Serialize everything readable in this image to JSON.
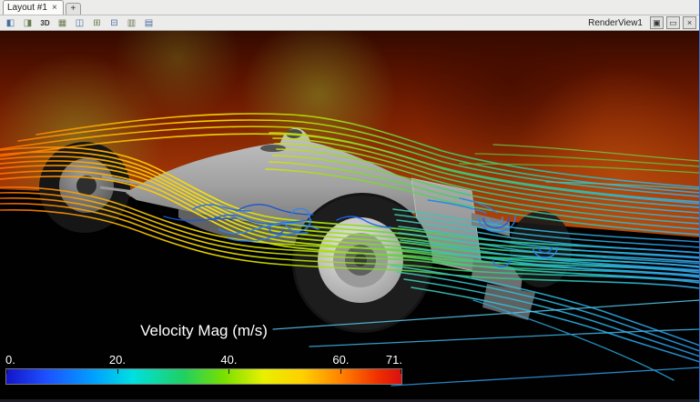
{
  "tabbar": {
    "tab_label": "Layout #1",
    "close_glyph": "×",
    "add_glyph": "+"
  },
  "toolbar": {
    "view_label": "RenderView1",
    "icons": [
      {
        "name": "split-horizontal",
        "glyph": "◧"
      },
      {
        "name": "split-vertical",
        "glyph": "◨"
      },
      {
        "name": "interaction-mode-3d",
        "glyph": "3D"
      },
      {
        "name": "grid",
        "glyph": "▦"
      },
      {
        "name": "split-view",
        "glyph": "◫"
      },
      {
        "name": "add-view",
        "glyph": "⊞"
      },
      {
        "name": "remove-view",
        "glyph": "⊟"
      },
      {
        "name": "preview",
        "glyph": "▥"
      },
      {
        "name": "fullscreen",
        "glyph": "▤"
      }
    ],
    "window_buttons": [
      {
        "name": "undock",
        "glyph": "▣"
      },
      {
        "name": "maximize",
        "glyph": "▭"
      },
      {
        "name": "close",
        "glyph": "×"
      }
    ]
  },
  "viewport": {
    "legend": {
      "title": "Velocity Mag (m/s)",
      "ticks": [
        "0.",
        "20.",
        "40.",
        "60.",
        "71."
      ],
      "range_min": 0,
      "range_max": 71,
      "colormap": [
        "#1414c8",
        "#00a0ff",
        "#00e0e0",
        "#20d060",
        "#e8f000",
        "#ff8000",
        "#d81010"
      ]
    }
  }
}
